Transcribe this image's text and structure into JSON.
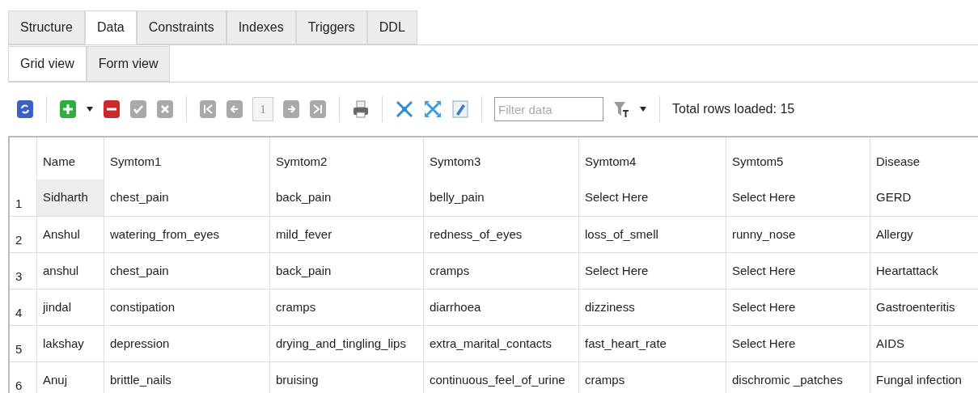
{
  "tabs": [
    {
      "label": "Structure",
      "selected": false
    },
    {
      "label": "Data",
      "selected": true
    },
    {
      "label": "Constraints",
      "selected": false
    },
    {
      "label": "Indexes",
      "selected": false
    },
    {
      "label": "Triggers",
      "selected": false
    },
    {
      "label": "DDL",
      "selected": false
    }
  ],
  "subtabs": [
    {
      "label": "Grid view",
      "selected": true
    },
    {
      "label": "Form view",
      "selected": false
    }
  ],
  "toolbar": {
    "page": "1",
    "filter": {
      "placeholder": "Filter data"
    },
    "status": "Total rows loaded: 15"
  },
  "table": {
    "columns": [
      "Name",
      "Symtom1",
      "Symtom2",
      "Symtom3",
      "Symtom4",
      "Symtom5",
      "Disease"
    ],
    "rows": [
      {
        "number": "1",
        "selected": true,
        "cells": [
          "Sidharth",
          "chest_pain",
          "back_pain",
          "belly_pain",
          "Select Here",
          "Select Here",
          "GERD"
        ]
      },
      {
        "number": "2",
        "selected": false,
        "cells": [
          "Anshul",
          "watering_from_eyes",
          "mild_fever",
          "redness_of_eyes",
          "loss_of_smell",
          "runny_nose",
          "Allergy"
        ]
      },
      {
        "number": "3",
        "selected": false,
        "cells": [
          "anshul",
          "chest_pain",
          "back_pain",
          "cramps",
          "Select Here",
          "Select Here",
          "Heartattack"
        ]
      },
      {
        "number": "4",
        "selected": false,
        "cells": [
          "jindal",
          "constipation",
          "cramps",
          "diarrhoea",
          "dizziness",
          "Select Here",
          "Gastroenteritis"
        ]
      },
      {
        "number": "5",
        "selected": false,
        "cells": [
          "lakshay",
          "depression",
          "drying_and_tingling_lips",
          "extra_marital_contacts",
          "fast_heart_rate",
          "Select Here",
          "AIDS"
        ]
      },
      {
        "number": "6",
        "selected": false,
        "cells": [
          "Anuj",
          "brittle_nails",
          "bruising",
          "continuous_feel_of_urine",
          "cramps",
          "dischromic _patches",
          "Fungal infection"
        ]
      }
    ]
  }
}
